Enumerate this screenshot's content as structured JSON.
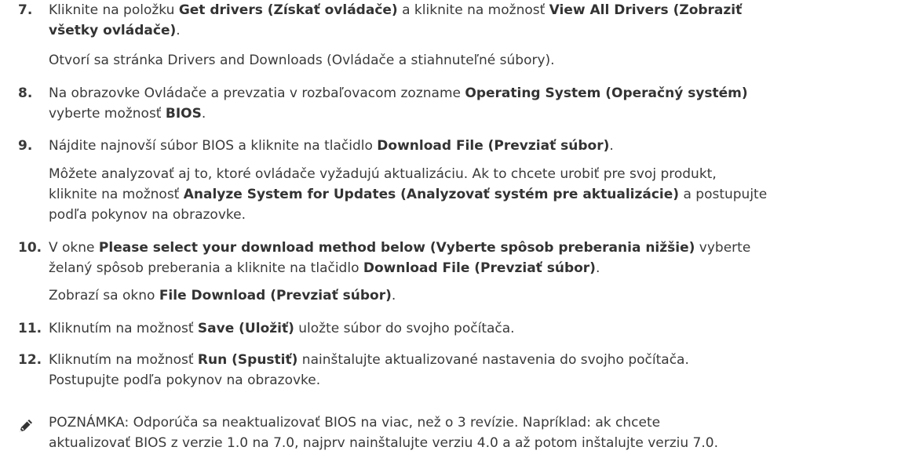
{
  "steps": [
    {
      "number": "7.",
      "lines": [
        [
          {
            "t": "Kliknite na položku ",
            "b": false
          },
          {
            "t": "Get drivers (Získať ovládače)",
            "b": true
          },
          {
            "t": " a kliknite na možnosť ",
            "b": false
          },
          {
            "t": "View All Drivers (Zobraziť",
            "b": true
          }
        ],
        [
          {
            "t": "všetky ovládače)",
            "b": true
          },
          {
            "t": ".",
            "b": false
          }
        ],
        [
          {
            "t": "Otvorí sa stránka Drivers and Downloads (Ovládače a stiahnuteľné súbory).",
            "b": false
          }
        ]
      ]
    },
    {
      "number": "8.",
      "lines": [
        [
          {
            "t": "Na obrazovke Ovládače a prevzatia v rozbaľovacom zozname ",
            "b": false
          },
          {
            "t": "Operating System (Operačný systém)",
            "b": true
          }
        ],
        [
          {
            "t": "vyberte možnosť ",
            "b": false
          },
          {
            "t": "BIOS",
            "b": true
          },
          {
            "t": ".",
            "b": false
          }
        ]
      ]
    },
    {
      "number": "9.",
      "lines": [
        [
          {
            "t": "Nájdite najnovší súbor BIOS a kliknite na tlačidlo ",
            "b": false
          },
          {
            "t": "Download File (Prevziať súbor)",
            "b": true
          },
          {
            "t": ".",
            "b": false
          }
        ],
        [
          {
            "t": "Môžete analyzovať aj to, ktoré ovládače vyžadujú aktualizáciu. Ak to chcete urobiť pre svoj produkt,",
            "b": false
          }
        ],
        [
          {
            "t": "kliknite na možnosť ",
            "b": false
          },
          {
            "t": "Analyze System for Updates (Analyzovať systém pre aktualizácie)",
            "b": true
          },
          {
            "t": " a postupujte",
            "b": false
          }
        ],
        [
          {
            "t": "podľa pokynov na obrazovke.",
            "b": false
          }
        ]
      ]
    },
    {
      "number": "10.",
      "lines": [
        [
          {
            "t": "V okne ",
            "b": false
          },
          {
            "t": "Please select your download method below (Vyberte spôsob preberania nižšie)",
            "b": true
          },
          {
            "t": " vyberte",
            "b": false
          }
        ],
        [
          {
            "t": "želaný spôsob preberania a kliknite na tlačidlo ",
            "b": false
          },
          {
            "t": "Download File (Prevziať súbor)",
            "b": true
          },
          {
            "t": ".",
            "b": false
          }
        ],
        [
          {
            "t": "Zobrazí sa okno ",
            "b": false
          },
          {
            "t": "File Download (Prevziať súbor)",
            "b": true
          },
          {
            "t": ".",
            "b": false
          }
        ]
      ]
    },
    {
      "number": "11.",
      "lines": [
        [
          {
            "t": "Kliknutím na možnosť ",
            "b": false
          },
          {
            "t": "Save (Uložiť)",
            "b": true
          },
          {
            "t": " uložte súbor do svojho počítača.",
            "b": false
          }
        ]
      ]
    },
    {
      "number": "12.",
      "lines": [
        [
          {
            "t": "Kliknutím na možnosť ",
            "b": false
          },
          {
            "t": "Run (Spustiť)",
            "b": true
          },
          {
            "t": " nainštalujte aktualizované nastavenia do svojho počítača.",
            "b": false
          }
        ],
        [
          {
            "t": "Postupujte podľa pokynov na obrazovke.",
            "b": false
          }
        ]
      ]
    }
  ],
  "note": {
    "icon": "pencil-icon",
    "lines": [
      [
        {
          "t": "POZNÁMKA:",
          "b": false
        },
        {
          "t": " Odporúča sa neaktualizovať BIOS na viac, než o 3 revízie. Napríklad: ak chcete",
          "b": false
        }
      ],
      [
        {
          "t": "aktualizovať BIOS z verzie 1.0 na 7.0, najprv nainštalujte verziu 4.0 a až potom inštalujte verziu 7.0.",
          "b": false
        }
      ]
    ]
  }
}
